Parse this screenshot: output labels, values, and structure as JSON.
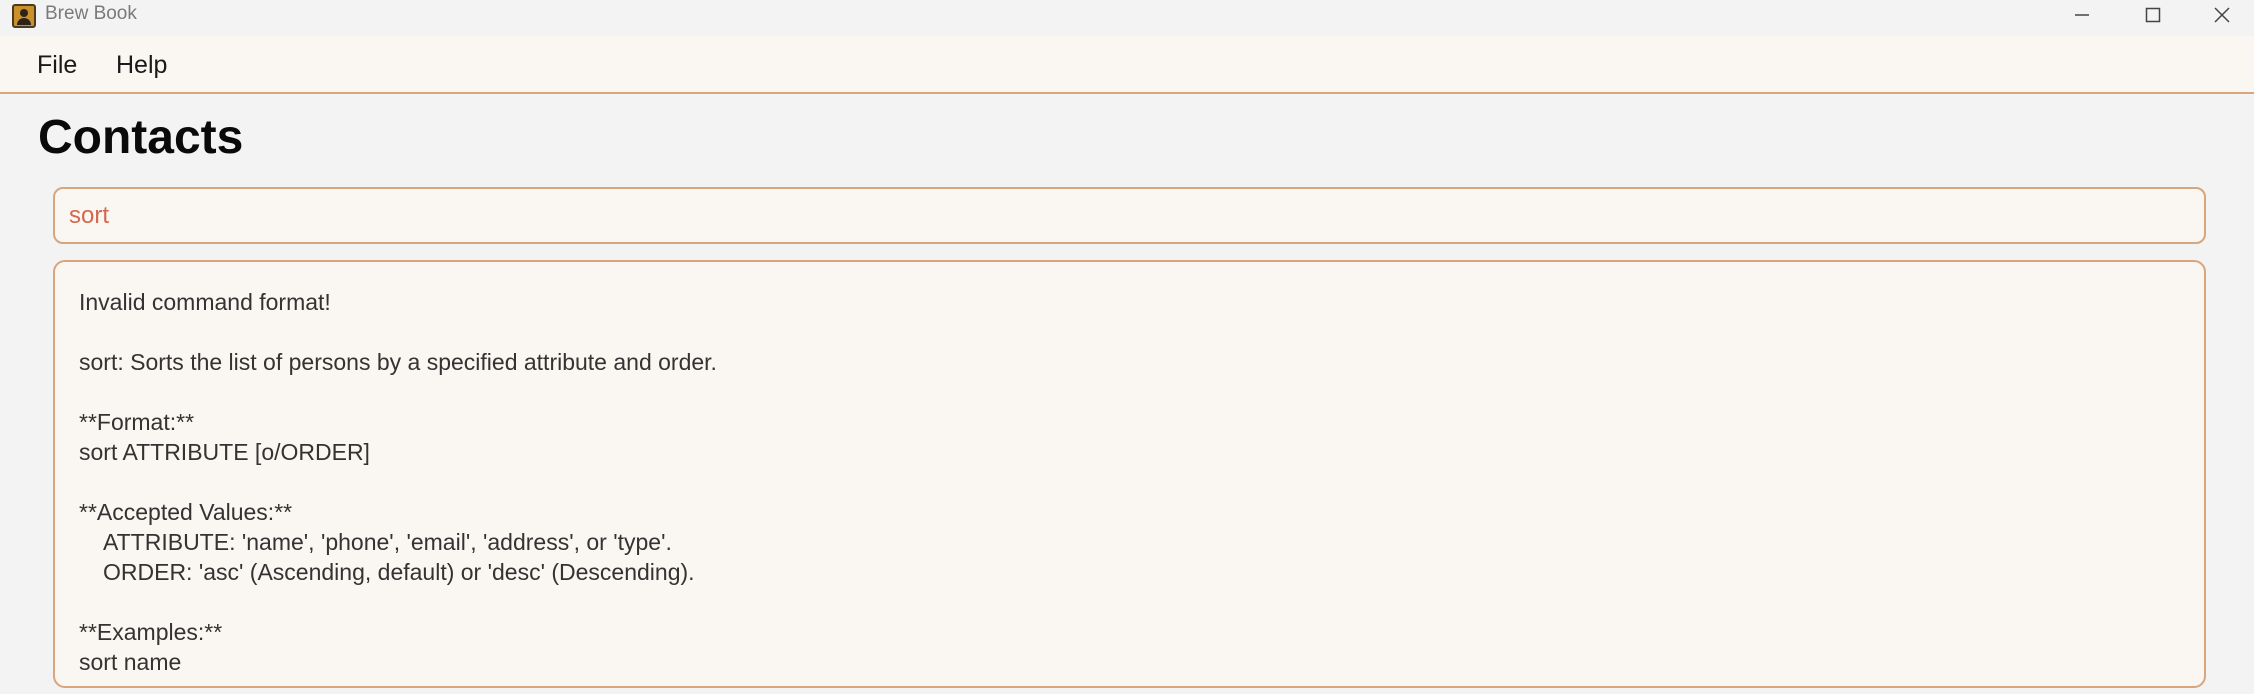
{
  "window": {
    "title": "Brew Book",
    "controls": [
      "minimize",
      "maximize",
      "close"
    ]
  },
  "menu": {
    "items": [
      {
        "label": "File"
      },
      {
        "label": "Help"
      }
    ]
  },
  "page": {
    "title": "Contacts"
  },
  "command": {
    "value": "sort"
  },
  "result": {
    "lines": {
      "l0": "Invalid command format!",
      "l1": "sort: Sorts the list of persons by a specified attribute and order.",
      "l2": "**Format:**",
      "l3": "sort ATTRIBUTE [o/ORDER]",
      "l4": "**Accepted Values:**",
      "l5": "ATTRIBUTE: 'name', 'phone', 'email', 'address', or 'type'.",
      "l6": "ORDER: 'asc' (Ascending, default) or 'desc' (Descending).",
      "l7": "**Examples:**",
      "l8": "sort name"
    }
  },
  "colors": {
    "accent_border": "#d9a57c",
    "command_text": "#d2694c",
    "panel_bg": "#faf6f1",
    "scroll_thumb": "#4e6e58"
  }
}
